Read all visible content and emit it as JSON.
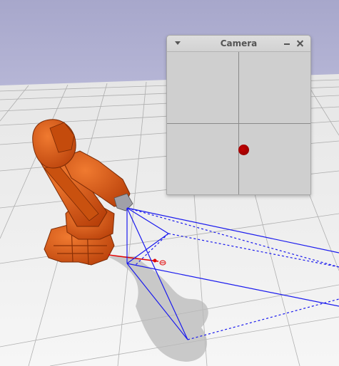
{
  "camera_window": {
    "title": "Camera",
    "menu_icon": "chevron-down-icon",
    "minimize_icon": "minimize-icon",
    "close_icon": "close-icon"
  },
  "colors": {
    "sky": "#a9a9cd",
    "floor": "#f2f2f2",
    "robot": "#e05a12",
    "frustum": "#1a1aee",
    "axis": "#e00000",
    "target": "#aa0000"
  }
}
